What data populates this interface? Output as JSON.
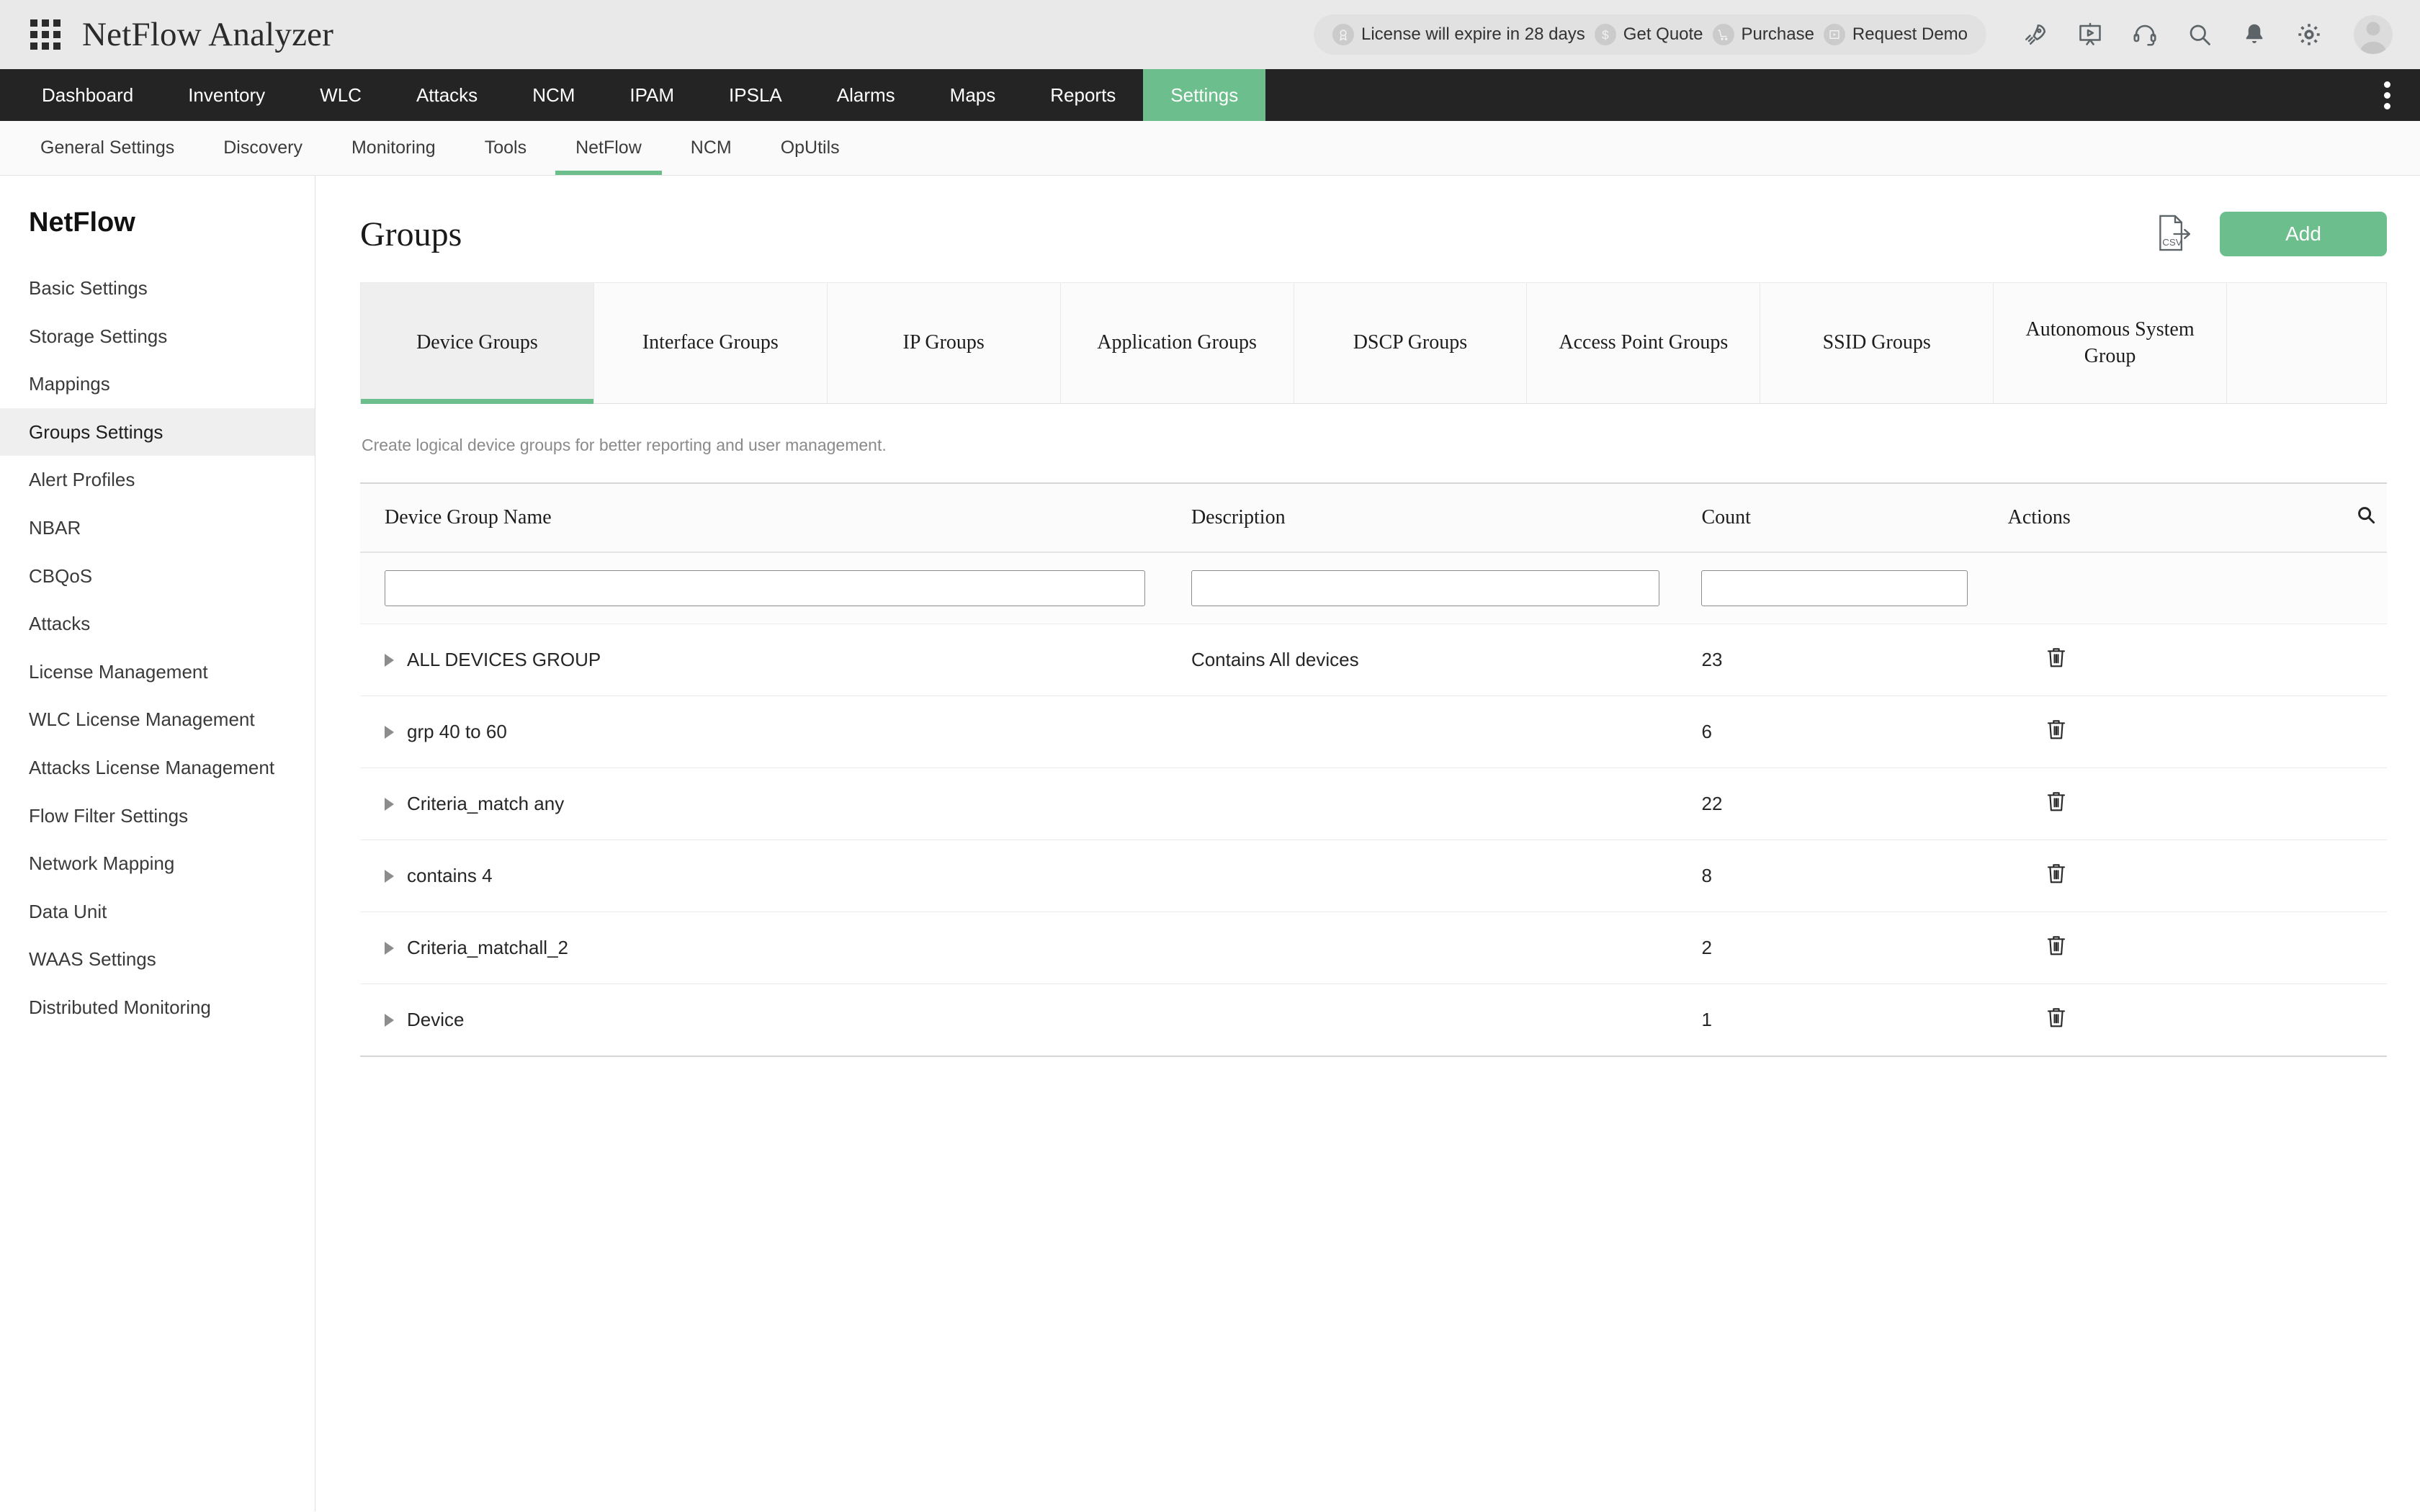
{
  "header": {
    "app_title": "NetFlow Analyzer",
    "grid_icon": "app-grid-icon",
    "license": [
      {
        "icon": "license-badge-icon",
        "glyph": "◎",
        "label": "License will expire in 28 days"
      },
      {
        "icon": "dollar-icon",
        "glyph": "$",
        "label": "Get Quote"
      },
      {
        "icon": "cart-icon",
        "glyph": "⑂",
        "label": "Purchase"
      },
      {
        "icon": "demo-video-icon",
        "glyph": "▣",
        "label": "Request Demo"
      }
    ],
    "icons": [
      "rocket-icon",
      "presentation-icon",
      "headset-icon",
      "search-icon",
      "bell-icon",
      "gear-icon",
      "avatar"
    ]
  },
  "mainnav": {
    "items": [
      {
        "label": "Dashboard",
        "active": false
      },
      {
        "label": "Inventory",
        "active": false
      },
      {
        "label": "WLC",
        "active": false
      },
      {
        "label": "Attacks",
        "active": false
      },
      {
        "label": "NCM",
        "active": false
      },
      {
        "label": "IPAM",
        "active": false
      },
      {
        "label": "IPSLA",
        "active": false
      },
      {
        "label": "Alarms",
        "active": false
      },
      {
        "label": "Maps",
        "active": false
      },
      {
        "label": "Reports",
        "active": false
      },
      {
        "label": "Settings",
        "active": true
      }
    ],
    "overflow_icon": "kebab-menu-icon"
  },
  "subnav": {
    "items": [
      {
        "label": "General Settings",
        "active": false
      },
      {
        "label": "Discovery",
        "active": false
      },
      {
        "label": "Monitoring",
        "active": false
      },
      {
        "label": "Tools",
        "active": false
      },
      {
        "label": "NetFlow",
        "active": true
      },
      {
        "label": "NCM",
        "active": false
      },
      {
        "label": "OpUtils",
        "active": false
      }
    ]
  },
  "sidebar": {
    "title": "NetFlow",
    "items": [
      {
        "label": "Basic Settings",
        "active": false
      },
      {
        "label": "Storage Settings",
        "active": false
      },
      {
        "label": "Mappings",
        "active": false
      },
      {
        "label": "Groups Settings",
        "active": true
      },
      {
        "label": "Alert Profiles",
        "active": false
      },
      {
        "label": "NBAR",
        "active": false
      },
      {
        "label": "CBQoS",
        "active": false
      },
      {
        "label": "Attacks",
        "active": false
      },
      {
        "label": "License Management",
        "active": false
      },
      {
        "label": "WLC License Management",
        "active": false
      },
      {
        "label": "Attacks License Management",
        "active": false
      },
      {
        "label": "Flow Filter Settings",
        "active": false
      },
      {
        "label": "Network Mapping",
        "active": false
      },
      {
        "label": "Data Unit",
        "active": false
      },
      {
        "label": "WAAS Settings",
        "active": false
      },
      {
        "label": "Distributed Monitoring",
        "active": false
      }
    ]
  },
  "main": {
    "page_title": "Groups",
    "csv_icon": "csv-export-icon",
    "csv_label": "CSV",
    "add_label": "Add",
    "helper_text": "Create logical device groups for better reporting and user management.",
    "tabs": [
      {
        "label": "Device Groups",
        "active": true
      },
      {
        "label": "Interface Groups",
        "active": false
      },
      {
        "label": "IP Groups",
        "active": false
      },
      {
        "label": "Application Groups",
        "active": false
      },
      {
        "label": "DSCP Groups",
        "active": false
      },
      {
        "label": "Access Point Groups",
        "active": false
      },
      {
        "label": "SSID Groups",
        "active": false
      },
      {
        "label": "Autonomous System Group",
        "active": false
      }
    ],
    "table": {
      "columns": [
        "Device Group Name",
        "Description",
        "Count",
        "Actions"
      ],
      "search_icon": "search-icon",
      "filters": [
        {
          "name": "device-group-name-filter",
          "value": "",
          "placeholder": ""
        },
        {
          "name": "description-filter",
          "value": "",
          "placeholder": ""
        },
        {
          "name": "count-filter",
          "value": "",
          "placeholder": ""
        }
      ],
      "rows": [
        {
          "name": "ALL DEVICES GROUP",
          "description": "Contains All devices",
          "count": "23",
          "action_icon": "trash-icon"
        },
        {
          "name": "grp 40 to 60",
          "description": "",
          "count": "6",
          "action_icon": "trash-icon"
        },
        {
          "name": "Criteria_match any",
          "description": "",
          "count": "22",
          "action_icon": "trash-icon"
        },
        {
          "name": "contains 4",
          "description": "",
          "count": "8",
          "action_icon": "trash-icon"
        },
        {
          "name": "Criteria_matchall_2",
          "description": "",
          "count": "2",
          "action_icon": "trash-icon"
        },
        {
          "name": "Device",
          "description": "",
          "count": "1",
          "action_icon": "trash-icon"
        }
      ]
    }
  },
  "colors": {
    "accent_green": "#6cbe8d",
    "nav_dark": "#242424",
    "header_gray": "#e9e9e9",
    "active_sidebar": "#efefef"
  }
}
